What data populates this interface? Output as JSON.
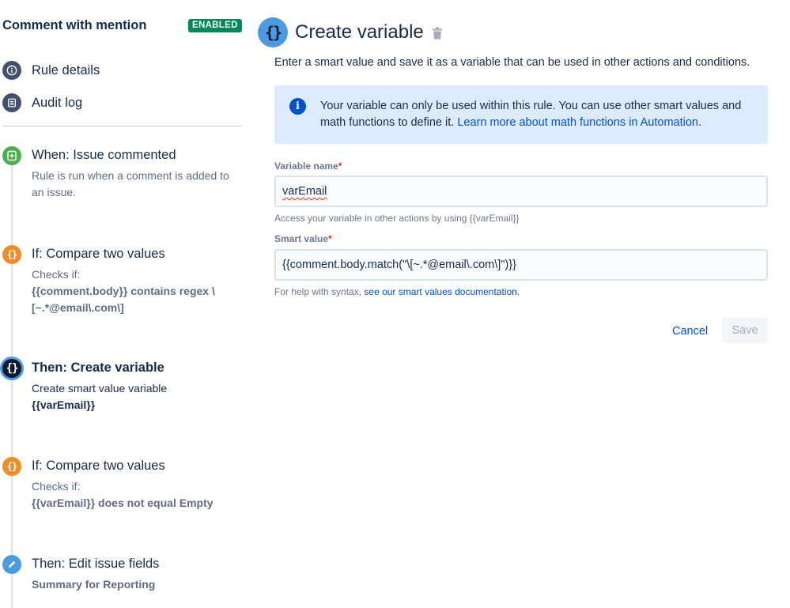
{
  "sidebar": {
    "rule_title": "Comment with mention",
    "status_badge": "ENABLED",
    "nav": [
      {
        "label": "Rule details",
        "icon": "info-icon"
      },
      {
        "label": "Audit log",
        "icon": "list-icon"
      }
    ],
    "steps": [
      {
        "title": "When: Issue commented",
        "desc": [
          "Rule is run when a comment is added to an issue."
        ],
        "icon": "trigger-icon",
        "color": "#4cae4c"
      },
      {
        "title": "If: Compare two values",
        "desc_label": "Checks if:",
        "desc_value": "{{comment.body}} contains regex \\[~.*@email\\.com\\]",
        "icon": "braces-icon",
        "color": "#f18d27"
      },
      {
        "title": "Then: Create variable",
        "desc_label": "Create smart value variable",
        "desc_value": "{{varEmail}}",
        "icon": "braces-icon",
        "color": "#0f1a2e",
        "active": true
      },
      {
        "title": "If: Compare two values",
        "desc_label": "Checks if:",
        "desc_value": "{{varEmail}} does not equal Empty",
        "icon": "braces-icon",
        "color": "#f18d27"
      },
      {
        "title": "Then: Edit issue fields",
        "desc_value": "Summary for Reporting",
        "icon": "pencil-icon",
        "color": "#4c9ae0"
      }
    ],
    "icon_glyph": "{}"
  },
  "main": {
    "title": "Create variable",
    "header_glyph": "{}",
    "intro": "Enter a smart value and save it as a variable that can be used in other actions and conditions.",
    "info": {
      "text": "Your variable can only be used within this rule. You can use other smart values and math functions to define it.",
      "link": "Learn more about math functions in Automation."
    },
    "variable_name": {
      "label": "Variable name",
      "required_mark": "*",
      "value": "varEmail",
      "helper": "Access your variable in other actions by using {{varEmail}}"
    },
    "smart_value": {
      "label": "Smart value",
      "required_mark": "*",
      "value": "{{comment.body.match(\"\\[~.*@email\\.com\\]\")}}",
      "helper_prefix": "For help with syntax,",
      "helper_link": "see our smart values documentation."
    },
    "cancel_label": "Cancel",
    "save_label": "Save"
  }
}
